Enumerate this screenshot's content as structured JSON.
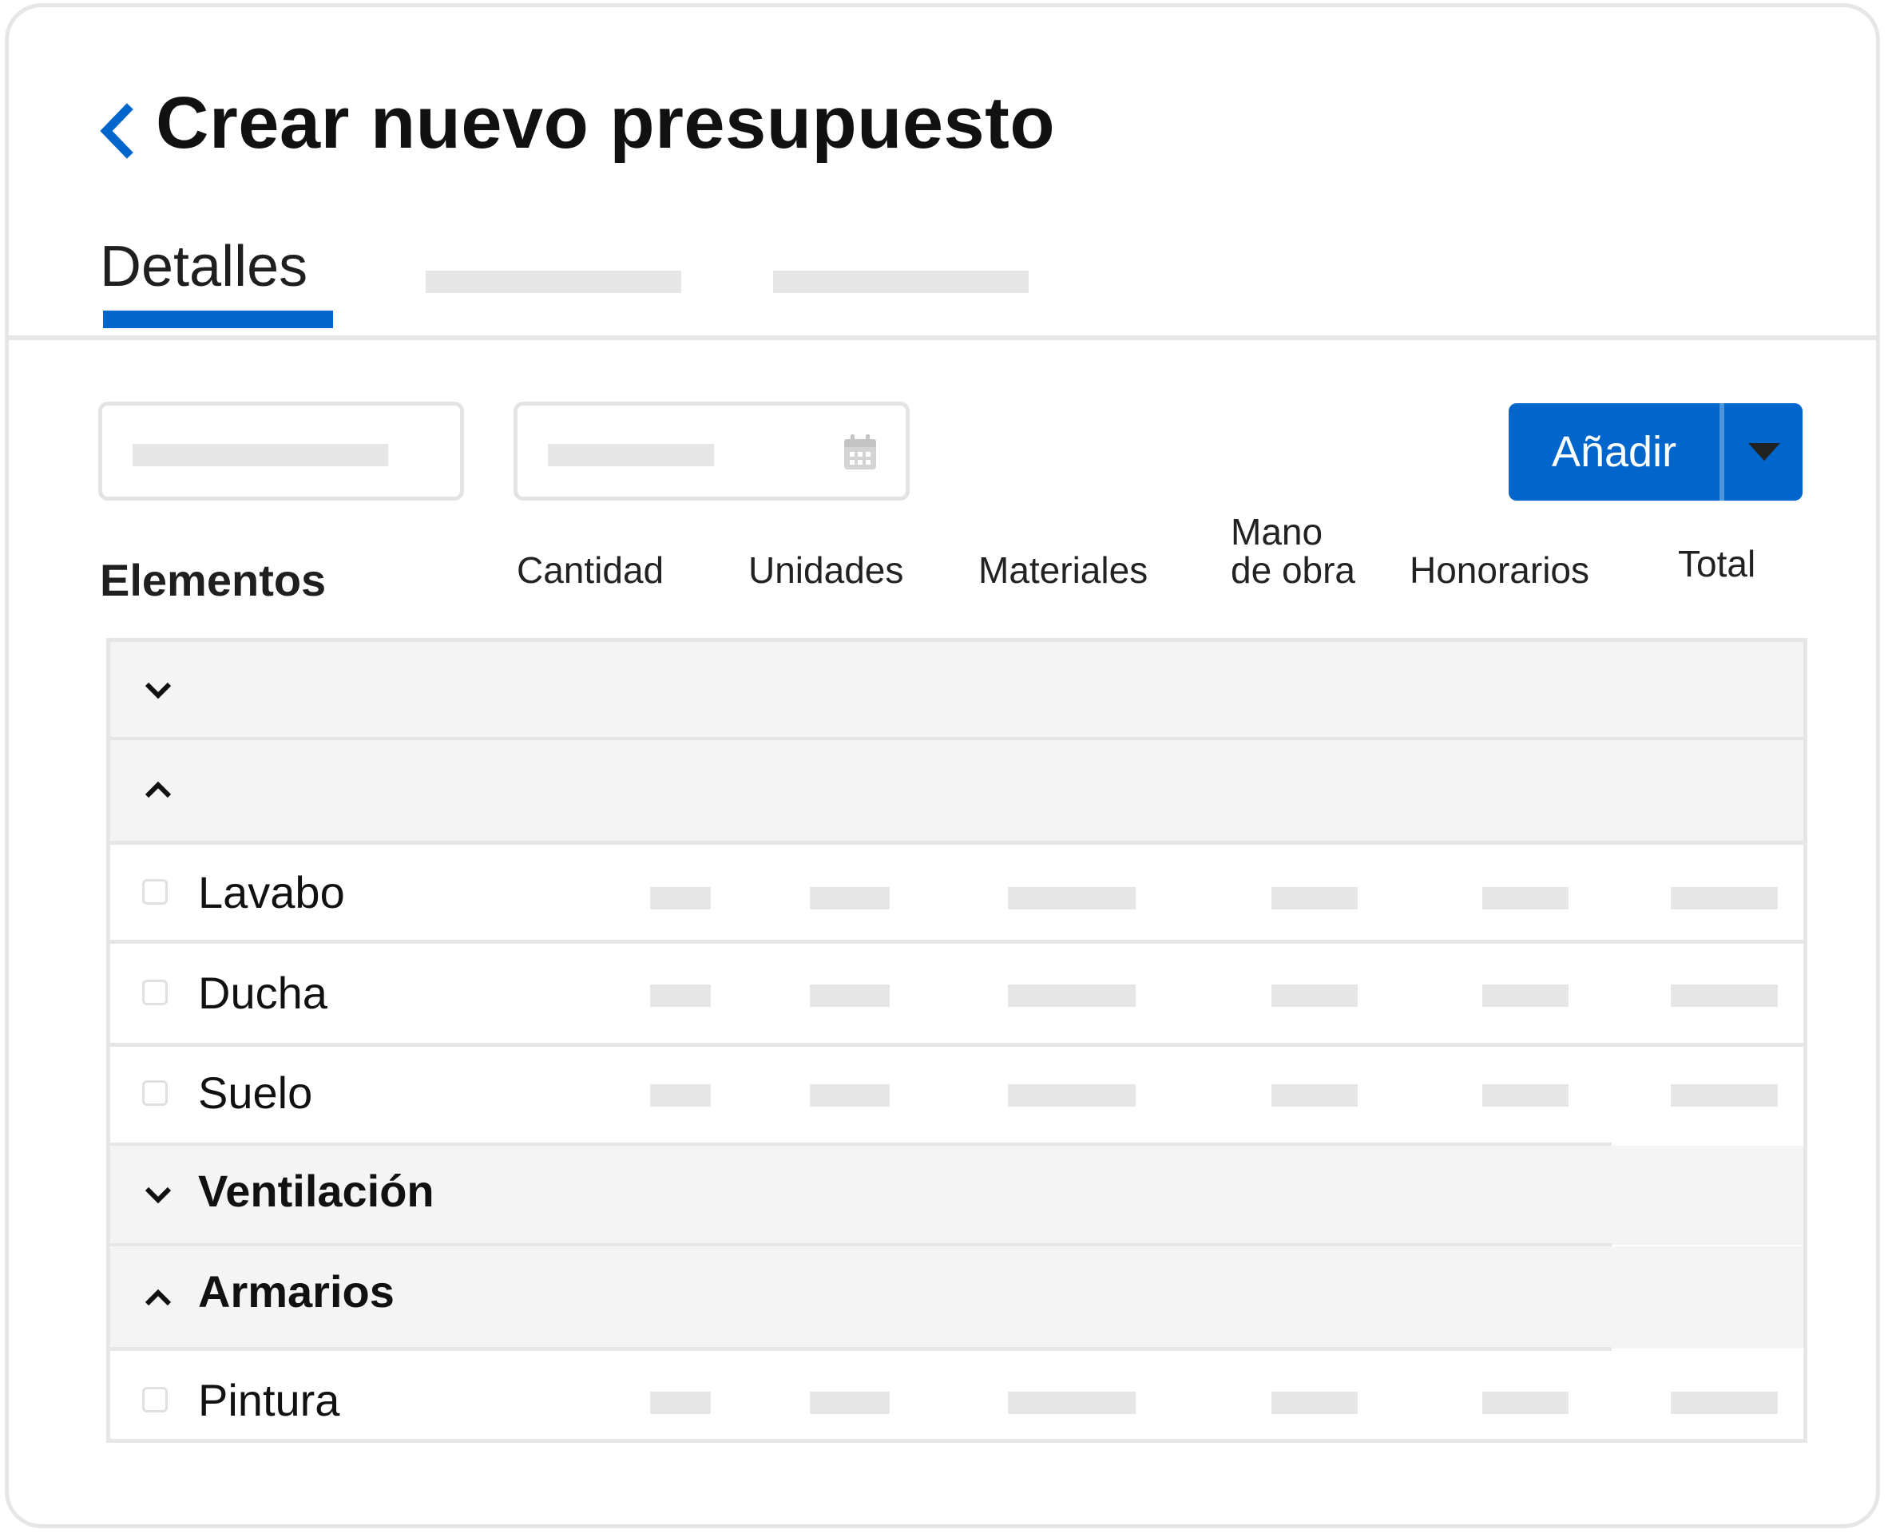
{
  "header": {
    "title": "Crear nuevo presupuesto",
    "back_icon": "chevron-left-icon"
  },
  "tabs": [
    {
      "label": "Detalles",
      "active": true
    },
    {
      "label": "",
      "active": false
    },
    {
      "label": "",
      "active": false
    }
  ],
  "form": {
    "field_1_value": "",
    "date_field_value": "",
    "date_icon": "calendar-icon"
  },
  "add_button": {
    "label": "Añadir",
    "caret_icon": "caret-down-icon"
  },
  "table": {
    "columns": {
      "elementos": "Elementos",
      "cantidad": "Cantidad",
      "unidades": "Unidades",
      "materiales": "Materiales",
      "mano_de_obra_1": "Mano",
      "mano_de_obra_2": "de obra",
      "honorarios": "Honorarios",
      "total": "Total"
    },
    "rows": [
      {
        "type": "group",
        "label": "",
        "expanded": false
      },
      {
        "type": "group",
        "label": "",
        "expanded": true
      },
      {
        "type": "item",
        "label": "Lavabo"
      },
      {
        "type": "item",
        "label": "Ducha"
      },
      {
        "type": "item",
        "label": "Suelo"
      },
      {
        "type": "group",
        "label": "Ventilación",
        "expanded": false
      },
      {
        "type": "group",
        "label": "Armarios",
        "expanded": true
      },
      {
        "type": "item",
        "label": "Pintura"
      }
    ]
  },
  "colors": {
    "accent": "#0066cc",
    "placeholder": "#e6e6e6",
    "group_row_bg": "#f4f4f4"
  }
}
